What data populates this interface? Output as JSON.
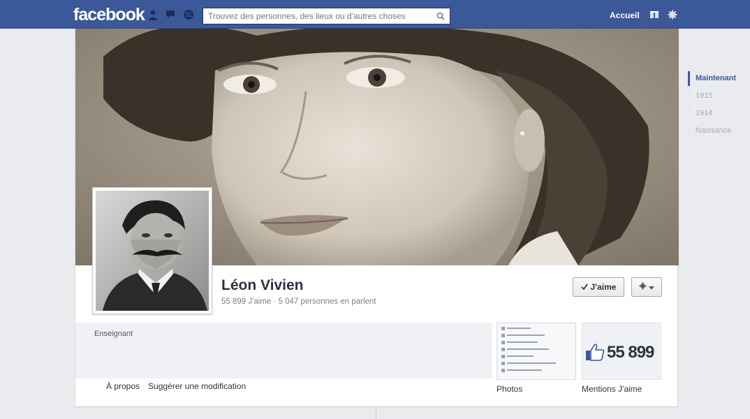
{
  "topbar": {
    "logo": "facebook",
    "search_placeholder": "Trouvez des personnes, des lieux ou d'autres choses",
    "home_label": "Accueil"
  },
  "profile": {
    "name": "Léon Vivien",
    "stats": "55 899 J'aime · 5 047 personnes en parlent",
    "category": "Enseignant",
    "like_button": "J'aime"
  },
  "links": {
    "about": "À propos",
    "suggest": "Suggérer une modification"
  },
  "apps": {
    "photos_label": "Photos",
    "likes_count": "55 899",
    "likes_label": "Mentions J'aime"
  },
  "timeline": [
    "Maintenant",
    "1915",
    "1914",
    "Naissance"
  ],
  "colors": {
    "brand": "#3b5998",
    "background": "#e9ebee"
  }
}
